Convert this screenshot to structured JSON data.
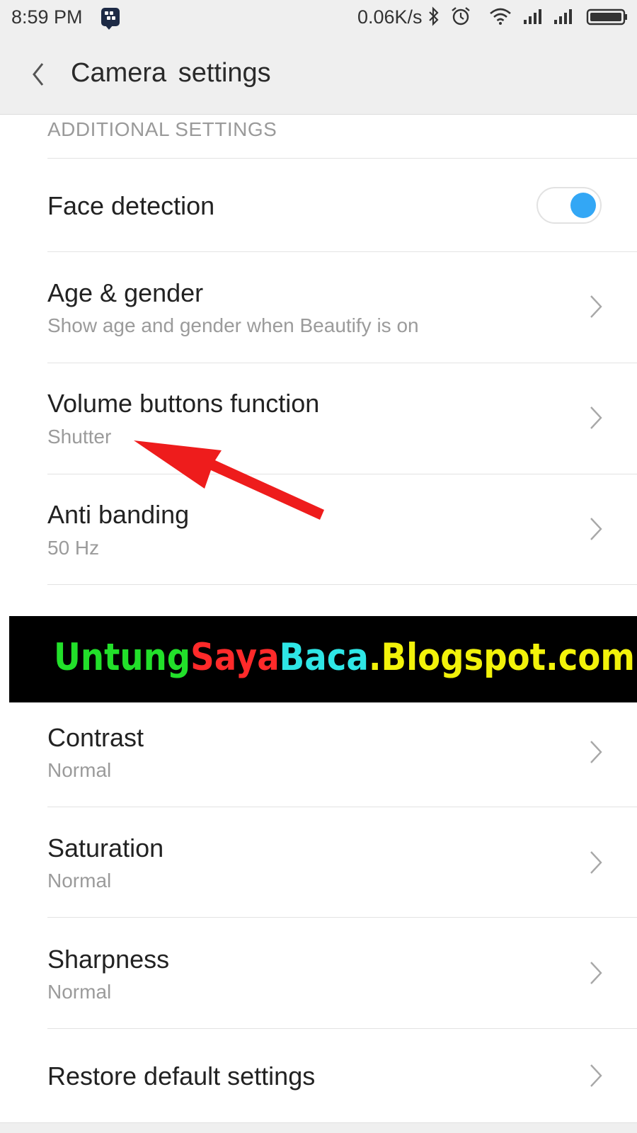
{
  "status_bar": {
    "time": "8:59 PM",
    "net_speed": "0.06K/s",
    "icons": [
      "bbm-icon",
      "bluetooth-icon",
      "alarm-icon",
      "wifi-icon",
      "signal-icon",
      "signal-icon-2",
      "battery-icon"
    ]
  },
  "app_bar": {
    "back_icon": "chevron-left-icon",
    "title": "Camera  settings"
  },
  "section": {
    "header": "ADDITIONAL SETTINGS"
  },
  "settings": {
    "face_detection": {
      "title": "Face detection",
      "toggle_on": true
    },
    "age_gender": {
      "title": "Age & gender",
      "subtitle": "Show age and gender when Beautify is on"
    },
    "volume_buttons": {
      "title": "Volume buttons function",
      "subtitle": "Shutter"
    },
    "anti_banding": {
      "title": "Anti banding",
      "subtitle": "50 Hz"
    },
    "contrast": {
      "title": "Contrast",
      "subtitle": "Normal"
    },
    "saturation": {
      "title": "Saturation",
      "subtitle": "Normal"
    },
    "sharpness": {
      "title": "Sharpness",
      "subtitle": "Normal"
    },
    "restore": {
      "title": "Restore default settings"
    }
  },
  "watermark": {
    "part1": "Untung",
    "part2": "Saya",
    "part3": "Baca",
    "part4": ".Blogspot.com"
  },
  "colors": {
    "toggle_on": "#33a7f5",
    "arrow": "#ee1c1c",
    "watermark_green": "#22e02a",
    "watermark_red": "#ff2a2a",
    "watermark_cyan": "#2ee6e6",
    "watermark_yellow": "#f2f20a"
  }
}
